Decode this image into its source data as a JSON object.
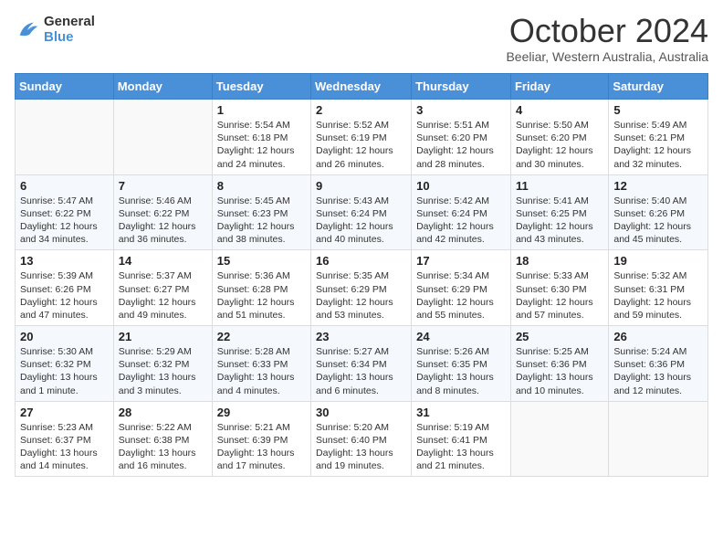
{
  "header": {
    "logo_text_general": "General",
    "logo_text_blue": "Blue",
    "month_title": "October 2024",
    "subtitle": "Beeliar, Western Australia, Australia"
  },
  "days_of_week": [
    "Sunday",
    "Monday",
    "Tuesday",
    "Wednesday",
    "Thursday",
    "Friday",
    "Saturday"
  ],
  "weeks": [
    [
      {
        "day": "",
        "info": ""
      },
      {
        "day": "",
        "info": ""
      },
      {
        "day": "1",
        "info": "Sunrise: 5:54 AM\nSunset: 6:18 PM\nDaylight: 12 hours and 24 minutes."
      },
      {
        "day": "2",
        "info": "Sunrise: 5:52 AM\nSunset: 6:19 PM\nDaylight: 12 hours and 26 minutes."
      },
      {
        "day": "3",
        "info": "Sunrise: 5:51 AM\nSunset: 6:20 PM\nDaylight: 12 hours and 28 minutes."
      },
      {
        "day": "4",
        "info": "Sunrise: 5:50 AM\nSunset: 6:20 PM\nDaylight: 12 hours and 30 minutes."
      },
      {
        "day": "5",
        "info": "Sunrise: 5:49 AM\nSunset: 6:21 PM\nDaylight: 12 hours and 32 minutes."
      }
    ],
    [
      {
        "day": "6",
        "info": "Sunrise: 5:47 AM\nSunset: 6:22 PM\nDaylight: 12 hours and 34 minutes."
      },
      {
        "day": "7",
        "info": "Sunrise: 5:46 AM\nSunset: 6:22 PM\nDaylight: 12 hours and 36 minutes."
      },
      {
        "day": "8",
        "info": "Sunrise: 5:45 AM\nSunset: 6:23 PM\nDaylight: 12 hours and 38 minutes."
      },
      {
        "day": "9",
        "info": "Sunrise: 5:43 AM\nSunset: 6:24 PM\nDaylight: 12 hours and 40 minutes."
      },
      {
        "day": "10",
        "info": "Sunrise: 5:42 AM\nSunset: 6:24 PM\nDaylight: 12 hours and 42 minutes."
      },
      {
        "day": "11",
        "info": "Sunrise: 5:41 AM\nSunset: 6:25 PM\nDaylight: 12 hours and 43 minutes."
      },
      {
        "day": "12",
        "info": "Sunrise: 5:40 AM\nSunset: 6:26 PM\nDaylight: 12 hours and 45 minutes."
      }
    ],
    [
      {
        "day": "13",
        "info": "Sunrise: 5:39 AM\nSunset: 6:26 PM\nDaylight: 12 hours and 47 minutes."
      },
      {
        "day": "14",
        "info": "Sunrise: 5:37 AM\nSunset: 6:27 PM\nDaylight: 12 hours and 49 minutes."
      },
      {
        "day": "15",
        "info": "Sunrise: 5:36 AM\nSunset: 6:28 PM\nDaylight: 12 hours and 51 minutes."
      },
      {
        "day": "16",
        "info": "Sunrise: 5:35 AM\nSunset: 6:29 PM\nDaylight: 12 hours and 53 minutes."
      },
      {
        "day": "17",
        "info": "Sunrise: 5:34 AM\nSunset: 6:29 PM\nDaylight: 12 hours and 55 minutes."
      },
      {
        "day": "18",
        "info": "Sunrise: 5:33 AM\nSunset: 6:30 PM\nDaylight: 12 hours and 57 minutes."
      },
      {
        "day": "19",
        "info": "Sunrise: 5:32 AM\nSunset: 6:31 PM\nDaylight: 12 hours and 59 minutes."
      }
    ],
    [
      {
        "day": "20",
        "info": "Sunrise: 5:30 AM\nSunset: 6:32 PM\nDaylight: 13 hours and 1 minute."
      },
      {
        "day": "21",
        "info": "Sunrise: 5:29 AM\nSunset: 6:32 PM\nDaylight: 13 hours and 3 minutes."
      },
      {
        "day": "22",
        "info": "Sunrise: 5:28 AM\nSunset: 6:33 PM\nDaylight: 13 hours and 4 minutes."
      },
      {
        "day": "23",
        "info": "Sunrise: 5:27 AM\nSunset: 6:34 PM\nDaylight: 13 hours and 6 minutes."
      },
      {
        "day": "24",
        "info": "Sunrise: 5:26 AM\nSunset: 6:35 PM\nDaylight: 13 hours and 8 minutes."
      },
      {
        "day": "25",
        "info": "Sunrise: 5:25 AM\nSunset: 6:36 PM\nDaylight: 13 hours and 10 minutes."
      },
      {
        "day": "26",
        "info": "Sunrise: 5:24 AM\nSunset: 6:36 PM\nDaylight: 13 hours and 12 minutes."
      }
    ],
    [
      {
        "day": "27",
        "info": "Sunrise: 5:23 AM\nSunset: 6:37 PM\nDaylight: 13 hours and 14 minutes."
      },
      {
        "day": "28",
        "info": "Sunrise: 5:22 AM\nSunset: 6:38 PM\nDaylight: 13 hours and 16 minutes."
      },
      {
        "day": "29",
        "info": "Sunrise: 5:21 AM\nSunset: 6:39 PM\nDaylight: 13 hours and 17 minutes."
      },
      {
        "day": "30",
        "info": "Sunrise: 5:20 AM\nSunset: 6:40 PM\nDaylight: 13 hours and 19 minutes."
      },
      {
        "day": "31",
        "info": "Sunrise: 5:19 AM\nSunset: 6:41 PM\nDaylight: 13 hours and 21 minutes."
      },
      {
        "day": "",
        "info": ""
      },
      {
        "day": "",
        "info": ""
      }
    ]
  ]
}
